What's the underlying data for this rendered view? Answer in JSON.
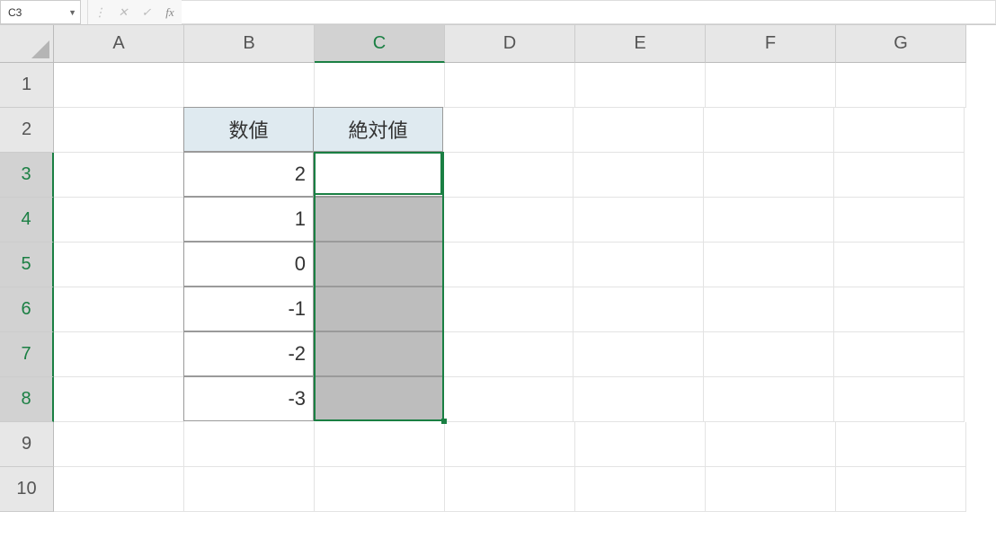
{
  "nameBox": "C3",
  "formula": "",
  "columns": [
    "A",
    "B",
    "C",
    "D",
    "E",
    "F",
    "G"
  ],
  "rowCount": 10,
  "selectedCol": "C",
  "selectedRows": [
    3,
    4,
    5,
    6,
    7,
    8
  ],
  "activeCell": "C3",
  "table": {
    "headers": {
      "B2": "数値",
      "C2": "絶対値"
    },
    "values": {
      "B3": "2",
      "B4": "1",
      "B5": "0",
      "B6": "-1",
      "B7": "-2",
      "B8": "-3"
    }
  }
}
